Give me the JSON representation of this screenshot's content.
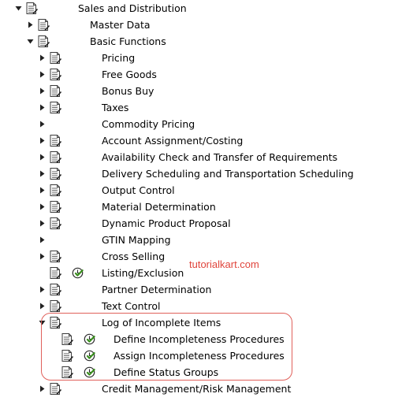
{
  "tree": [
    {
      "level": 0,
      "arrow": "down",
      "icon": "doc",
      "label": "Sales and Distribution"
    },
    {
      "level": 1,
      "arrow": "right",
      "icon": "doc",
      "label": "Master Data"
    },
    {
      "level": 1,
      "arrow": "down",
      "icon": "doc",
      "label": "Basic Functions"
    },
    {
      "level": 2,
      "arrow": "right",
      "icon": "doc",
      "label": "Pricing"
    },
    {
      "level": 2,
      "arrow": "right",
      "icon": "doc",
      "label": "Free Goods"
    },
    {
      "level": 2,
      "arrow": "right",
      "icon": "doc",
      "label": "Bonus Buy"
    },
    {
      "level": 2,
      "arrow": "right",
      "icon": "doc",
      "label": "Taxes"
    },
    {
      "level": 2,
      "arrow": "right",
      "icon": "none",
      "label": "Commodity Pricing"
    },
    {
      "level": 2,
      "arrow": "right",
      "icon": "doc",
      "label": "Account Assignment/Costing"
    },
    {
      "level": 2,
      "arrow": "right",
      "icon": "doc",
      "label": "Availability Check and Transfer of Requirements"
    },
    {
      "level": 2,
      "arrow": "right",
      "icon": "doc",
      "label": "Delivery Scheduling and Transportation Scheduling"
    },
    {
      "level": 2,
      "arrow": "right",
      "icon": "doc",
      "label": "Output Control"
    },
    {
      "level": 2,
      "arrow": "right",
      "icon": "doc",
      "label": "Material Determination"
    },
    {
      "level": 2,
      "arrow": "right",
      "icon": "doc",
      "label": "Dynamic Product Proposal"
    },
    {
      "level": 2,
      "arrow": "right",
      "icon": "none",
      "label": "GTIN Mapping"
    },
    {
      "level": 2,
      "arrow": "right",
      "icon": "doc",
      "label": "Cross Selling"
    },
    {
      "level": 2,
      "arrow": "none",
      "icon": "doc-clock",
      "label": "Listing/Exclusion"
    },
    {
      "level": 2,
      "arrow": "right",
      "icon": "doc",
      "label": "Partner Determination"
    },
    {
      "level": 2,
      "arrow": "right",
      "icon": "doc",
      "label": "Text Control"
    },
    {
      "level": 2,
      "arrow": "down",
      "icon": "doc",
      "label": "Log of Incomplete Items"
    },
    {
      "level": 3,
      "arrow": "none",
      "icon": "doc-clock",
      "label": "Define Incompleteness Procedures"
    },
    {
      "level": 3,
      "arrow": "none",
      "icon": "doc-clock",
      "label": "Assign Incompleteness Procedures"
    },
    {
      "level": 3,
      "arrow": "none",
      "icon": "doc-clock",
      "label": "Define Status Groups"
    },
    {
      "level": 2,
      "arrow": "right",
      "icon": "doc",
      "label": "Credit Management/Risk Management"
    }
  ],
  "watermark": "tutorialkart.com",
  "colors": {
    "highlight": "#e0605a",
    "watermark": "#e0453c",
    "clock": "#3a8f1e"
  }
}
